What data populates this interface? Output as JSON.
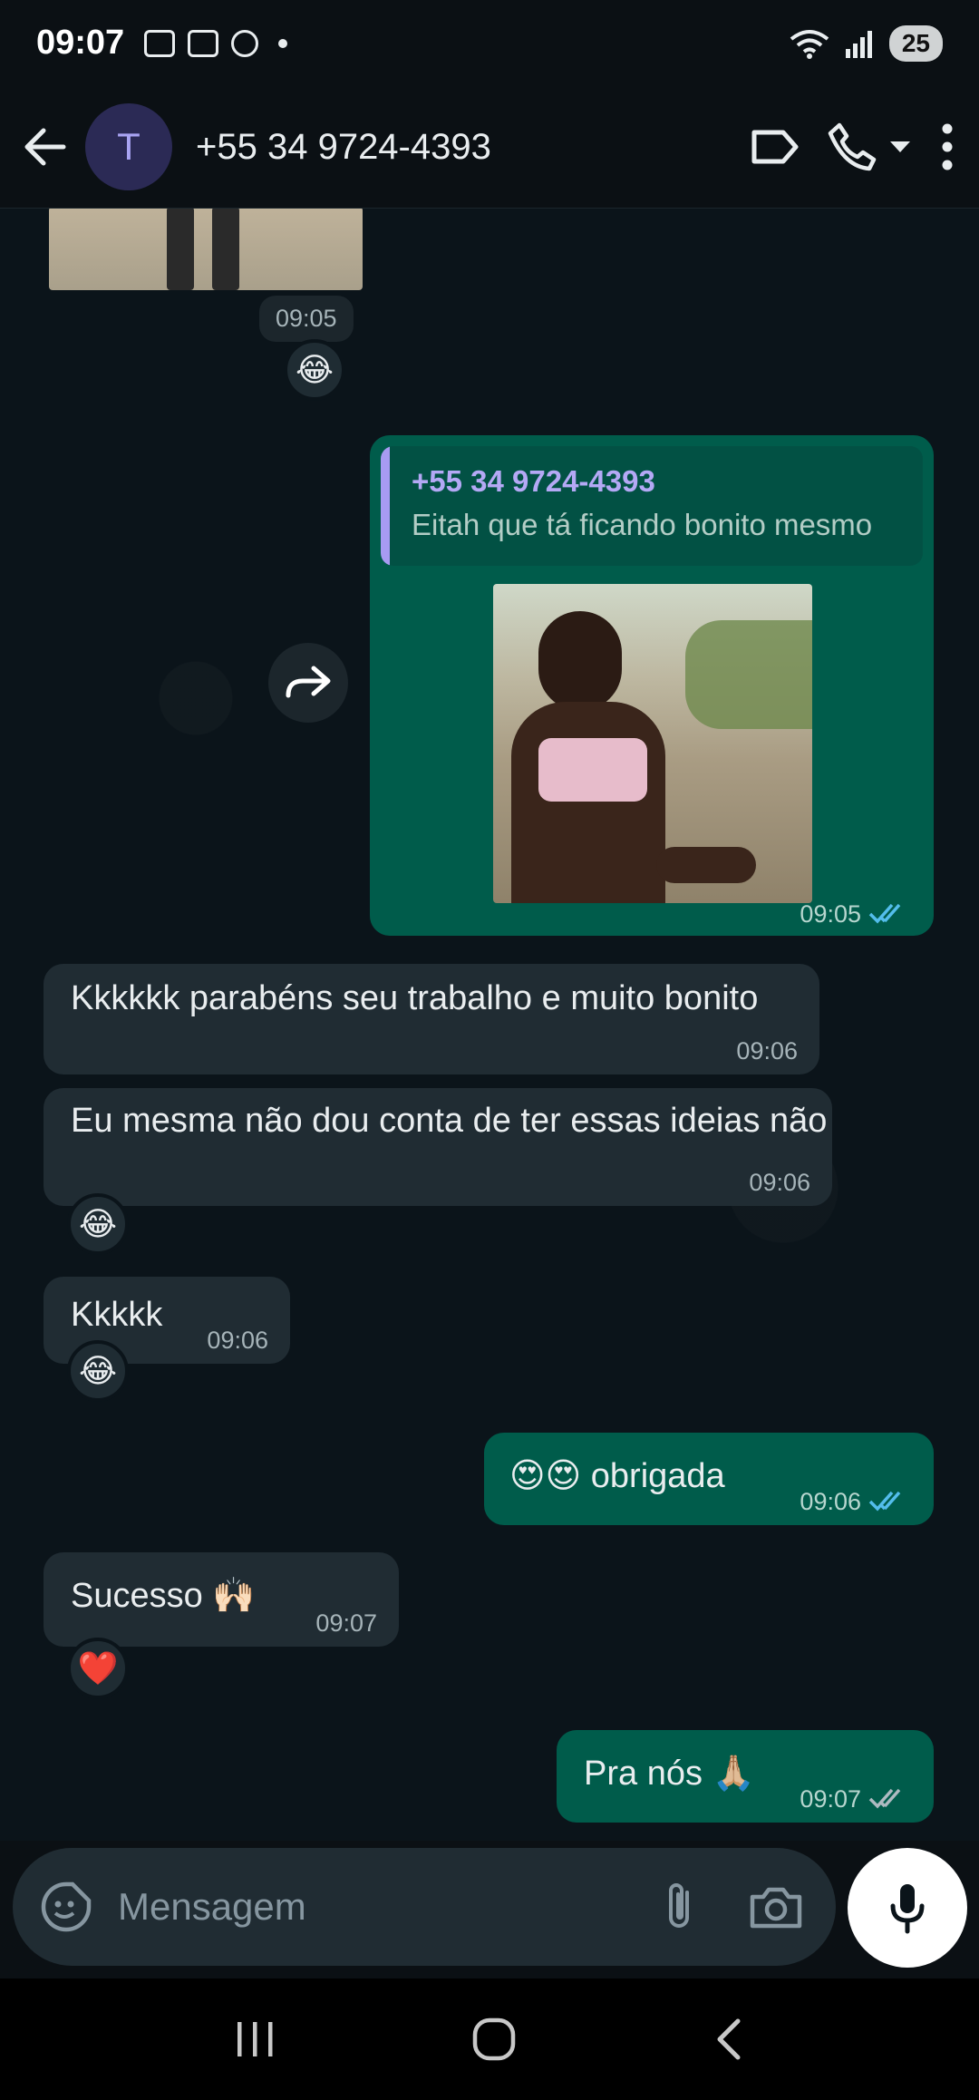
{
  "status_bar": {
    "time": "09:07",
    "battery": "25"
  },
  "header": {
    "avatar_letter": "T",
    "contact_name": "+55 34 9724-4393"
  },
  "chat": {
    "top_image_time": "09:05",
    "top_image_reaction": "😂",
    "outgoing_reply": {
      "quote_name": "+55 34 9724-4393",
      "quote_text": "Eitah que tá ficando bonito mesmo",
      "time": "09:05"
    },
    "messages": [
      {
        "text": "Kkkkkk parabéns seu trabalho e muito bonito",
        "time": "09:06"
      },
      {
        "text": "Eu mesma não dou conta de ter essas ideias não",
        "time": "09:06",
        "reaction": "😂"
      },
      {
        "text": "Kkkkk",
        "time": "09:06",
        "reaction": "😂"
      },
      {
        "text": "😍😍 obrigada",
        "time": "09:06"
      },
      {
        "text": "Sucesso 🙌🏻",
        "time": "09:07",
        "reaction": "❤️"
      },
      {
        "text": "Pra nós 🙏🏼",
        "time": "09:07"
      }
    ]
  },
  "composer": {
    "placeholder": "Mensagem"
  },
  "colors": {
    "incoming_bubble": "#202c33",
    "outgoing_bubble": "#005c4b",
    "read_ticks": "#53bdeb",
    "delivered_ticks": "#aebac1"
  }
}
